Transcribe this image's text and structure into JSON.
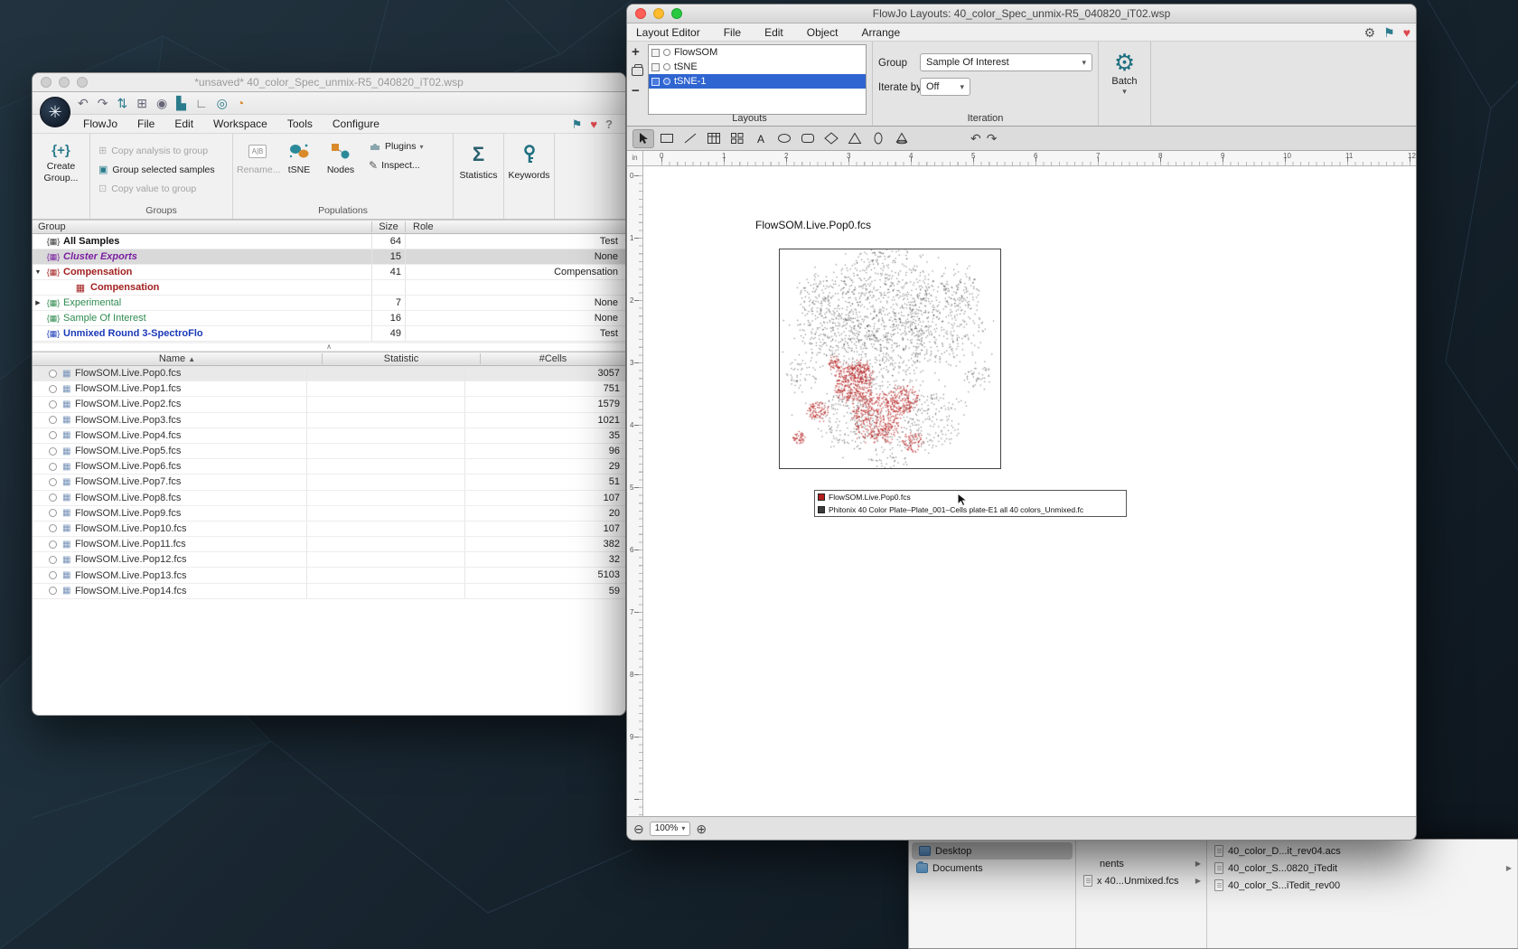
{
  "workspace_window": {
    "title": "*unsaved* 40_color_Spec_unmix-R5_040820_iT02.wsp",
    "logo_glyph": "✳",
    "menus": [
      {
        "label": "FlowJo",
        "name": "menu-flowjo"
      },
      {
        "label": "File",
        "name": "menu-file"
      },
      {
        "label": "Edit",
        "name": "menu-edit"
      },
      {
        "label": "Workspace",
        "name": "menu-workspace"
      },
      {
        "label": "Tools",
        "name": "menu-tools"
      },
      {
        "label": "Configure",
        "name": "menu-configure"
      }
    ],
    "quick_icons": [
      {
        "glyph": "↶",
        "name": "undo-button",
        "cls": "plain"
      },
      {
        "glyph": "↷",
        "name": "redo-button",
        "cls": "plain"
      },
      {
        "glyph": "⇅",
        "name": "transfer-icon",
        "cls": "teal"
      },
      {
        "glyph": "⊞",
        "name": "add-table-icon",
        "cls": "plain"
      },
      {
        "glyph": "◉",
        "name": "search-icon",
        "cls": "plain"
      },
      {
        "glyph": "▙",
        "name": "chart-icon",
        "cls": "teal"
      },
      {
        "glyph": "∟",
        "name": "layout-icon",
        "cls": "plain"
      },
      {
        "glyph": "◎",
        "name": "record-icon",
        "cls": "teal"
      },
      {
        "glyph": "◔",
        "name": "palette-icon",
        "cls": "orange"
      }
    ],
    "corner_icons": [
      {
        "glyph": "⚑",
        "name": "bookmark-icon",
        "cls": "teal"
      },
      {
        "glyph": "♥",
        "name": "favorites-icon",
        "cls": "red"
      },
      {
        "glyph": "?",
        "name": "help-icon",
        "cls": "gray"
      }
    ],
    "ribbon": {
      "create_group_icon": "{+}",
      "create_group_label": "Create Group...",
      "group_actions": [
        {
          "glyph": "⊞",
          "label": "Copy analysis to group",
          "name": "copy-analysis-button",
          "disabled": true
        },
        {
          "glyph": "▣",
          "label": "Group selected samples",
          "name": "group-selected-button"
        },
        {
          "glyph": "⊡",
          "label": "Copy value to group",
          "name": "copy-value-button",
          "disabled": true
        }
      ],
      "groups_caption": "Groups",
      "rename_icon": "A|B",
      "rename_label": "Rename...",
      "tsne_label": "tSNE",
      "nodes_label": "Nodes",
      "plugins_label": "Plugins",
      "plugins_caret": "▾",
      "inspect_icon": "✎",
      "inspect_label": "Inspect...",
      "populations_caption": "Populations",
      "statistics_icon": "Σ",
      "statistics_label": "Statistics",
      "keywords_label": "Keywords"
    },
    "groups_table": {
      "columns": {
        "group": "Group",
        "size": "Size",
        "role": "Role"
      },
      "rows": [
        {
          "disclosure": "",
          "icon": "braces",
          "name": "All Samples",
          "size": "64",
          "role": "Test",
          "style": "g-dark"
        },
        {
          "disclosure": "",
          "icon": "braces",
          "name": "Cluster Exports",
          "size": "15",
          "role": "None",
          "style": "g-purple",
          "selected": true
        },
        {
          "disclosure": "▼",
          "icon": "braces",
          "name": "Compensation",
          "size": "41",
          "role": "Compensation",
          "style": "g-red"
        },
        {
          "disclosure": "",
          "icon": "grid",
          "name": "Compensation",
          "size": "",
          "role": "",
          "style": "g-red",
          "indent": true
        },
        {
          "disclosure": "▶",
          "icon": "braces",
          "name": "Experimental",
          "size": "7",
          "role": "None",
          "style": "g-green"
        },
        {
          "disclosure": "",
          "icon": "braces",
          "name": "Sample Of Interest",
          "size": "16",
          "role": "None",
          "style": "g-green"
        },
        {
          "disclosure": "",
          "icon": "braces",
          "name": "Unmixed Round 3-SpectroFlo",
          "size": "49",
          "role": "Test",
          "style": "g-blue"
        }
      ]
    },
    "scroll_hint": "∧",
    "samples_table": {
      "columns": {
        "name": "Name",
        "statistic": "Statistic",
        "cells": "#Cells"
      },
      "sort_icon": "▲",
      "rows": [
        {
          "name": "FlowSOM.Live.Pop0.fcs",
          "statistic": "",
          "cells": "3057",
          "selected": true
        },
        {
          "name": "FlowSOM.Live.Pop1.fcs",
          "statistic": "",
          "cells": "751"
        },
        {
          "name": "FlowSOM.Live.Pop2.fcs",
          "statistic": "",
          "cells": "1579"
        },
        {
          "name": "FlowSOM.Live.Pop3.fcs",
          "statistic": "",
          "cells": "1021"
        },
        {
          "name": "FlowSOM.Live.Pop4.fcs",
          "statistic": "",
          "cells": "35"
        },
        {
          "name": "FlowSOM.Live.Pop5.fcs",
          "statistic": "",
          "cells": "96"
        },
        {
          "name": "FlowSOM.Live.Pop6.fcs",
          "statistic": "",
          "cells": "29"
        },
        {
          "name": "FlowSOM.Live.Pop7.fcs",
          "statistic": "",
          "cells": "51"
        },
        {
          "name": "FlowSOM.Live.Pop8.fcs",
          "statistic": "",
          "cells": "107"
        },
        {
          "name": "FlowSOM.Live.Pop9.fcs",
          "statistic": "",
          "cells": "20"
        },
        {
          "name": "FlowSOM.Live.Pop10.fcs",
          "statistic": "",
          "cells": "107"
        },
        {
          "name": "FlowSOM.Live.Pop11.fcs",
          "statistic": "",
          "cells": "382"
        },
        {
          "name": "FlowSOM.Live.Pop12.fcs",
          "statistic": "",
          "cells": "32"
        },
        {
          "name": "FlowSOM.Live.Pop13.fcs",
          "statistic": "",
          "cells": "5103"
        },
        {
          "name": "FlowSOM.Live.Pop14.fcs",
          "statistic": "",
          "cells": "59"
        }
      ]
    }
  },
  "layout_window": {
    "title": "FlowJo Layouts: 40_color_Spec_unmix-R5_040820_iT02.wsp",
    "menus": [
      {
        "label": "Layout Editor",
        "name": "menu-layout-editor"
      },
      {
        "label": "File",
        "name": "menu-file"
      },
      {
        "label": "Edit",
        "name": "menu-edit"
      },
      {
        "label": "Object",
        "name": "menu-object"
      },
      {
        "label": "Arrange",
        "name": "menu-arrange"
      }
    ],
    "window_icons": [
      {
        "glyph": "⚙",
        "name": "settings-icon",
        "cls": "dark"
      },
      {
        "glyph": "⚑",
        "name": "bookmark-icon",
        "cls": "teal"
      },
      {
        "glyph": "♥",
        "name": "favorites-icon",
        "cls": "red"
      }
    ],
    "layouts_panel": {
      "add_label": "+",
      "remove_label": "−",
      "items": [
        {
          "label": "FlowSOM"
        },
        {
          "label": "tSNE"
        },
        {
          "label": "tSNE-1",
          "selected": true
        }
      ],
      "caption": "Layouts"
    },
    "group_label": "Group",
    "group_value": "Sample Of Interest",
    "iterate_label": "Iterate by",
    "iterate_value": "Off",
    "iteration_caption": "Iteration",
    "batch_label": "Batch",
    "caret": "▾",
    "tools_a": "A",
    "undo_icon": "↶",
    "redo_icon": "↷",
    "ruler": {
      "unit": "in",
      "h": [
        "0",
        "1",
        "2",
        "3",
        "4",
        "5",
        "6",
        "7",
        "8",
        "9",
        "10",
        "11",
        "12"
      ],
      "v": [
        "0",
        "1",
        "2",
        "3",
        "4",
        "5",
        "6",
        "7",
        "8",
        "9"
      ]
    },
    "page": {
      "plot_title": "FlowSOM.Live.Pop0.fcs",
      "legend": [
        {
          "color": "#b51d1d",
          "label": "FlowSOM.Live.Pop0.fcs"
        },
        {
          "color": "#3a3a3a",
          "label": "Phitonix 40 Color Plate–Plate_001–Cells plate-E1 all 40 colors_Unmixed.fc"
        }
      ]
    },
    "zoom_out": "⊖",
    "zoom_in": "⊕",
    "zoom_value": "100%"
  },
  "finder_window": {
    "col1": [
      {
        "label": "Desktop",
        "icon": "desktop",
        "selected": true
      },
      {
        "label": "Documents",
        "icon": "folder"
      }
    ],
    "col2": [
      {
        "label": "nents",
        "chevron": "▶"
      },
      {
        "label": "x 40...Unmixed.fcs",
        "icon": "doc",
        "chevron": "▶"
      }
    ],
    "col3": [
      {
        "label": "40_color_D...it_rev04.acs",
        "icon": "doc"
      },
      {
        "label": "40_color_S...0820_iTedit",
        "icon": "doc",
        "chevron": "▶"
      },
      {
        "label": "40_color_S...iTedit_rev00",
        "icon": "doc"
      }
    ]
  },
  "chart_data": {
    "type": "scatter",
    "title": "FlowSOM.Live.Pop0.fcs",
    "plot_size": [
      244,
      242
    ],
    "legend_entries": [
      "FlowSOM.Live.Pop0.fcs",
      "Phitonix 40 Color Plate–Plate_001–Cells plate-E1 all 40 colors_Unmixed.fc"
    ],
    "series": [
      {
        "name": "Phitonix 40 Color Plate–Plate_001–Cells plate-E1 all 40 colors_Unmixed.fc",
        "color": "#1c1c1c",
        "alpha": 0.55,
        "clusters": [
          {
            "x": 115,
            "y": 52,
            "r": 55,
            "n": 520
          },
          {
            "x": 55,
            "y": 88,
            "r": 36,
            "n": 240
          },
          {
            "x": 178,
            "y": 78,
            "r": 44,
            "n": 300
          },
          {
            "x": 115,
            "y": 112,
            "r": 50,
            "n": 300
          },
          {
            "x": 40,
            "y": 48,
            "r": 22,
            "n": 80
          },
          {
            "x": 198,
            "y": 42,
            "r": 24,
            "n": 85
          },
          {
            "x": 76,
            "y": 188,
            "r": 32,
            "n": 150
          },
          {
            "x": 166,
            "y": 188,
            "r": 32,
            "n": 150
          },
          {
            "x": 24,
            "y": 138,
            "r": 17,
            "n": 45
          },
          {
            "x": 221,
            "y": 138,
            "r": 16,
            "n": 45
          },
          {
            "x": 120,
            "y": 118,
            "r": 110,
            "n": 280
          },
          {
            "x": 120,
            "y": 222,
            "r": 24,
            "n": 60
          }
        ]
      },
      {
        "name": "FlowSOM.Live.Pop0.fcs",
        "color": "#b51d1d",
        "alpha": 0.9,
        "clusters": [
          {
            "x": 80,
            "y": 148,
            "r": 21,
            "n": 340
          },
          {
            "x": 108,
            "y": 186,
            "r": 27,
            "n": 440
          },
          {
            "x": 137,
            "y": 165,
            "r": 16,
            "n": 170
          },
          {
            "x": 42,
            "y": 178,
            "r": 11,
            "n": 90
          },
          {
            "x": 20,
            "y": 208,
            "r": 7,
            "n": 45
          },
          {
            "x": 147,
            "y": 213,
            "r": 11,
            "n": 70
          },
          {
            "x": 88,
            "y": 135,
            "r": 13,
            "n": 110
          },
          {
            "x": 60,
            "y": 126,
            "r": 8,
            "n": 50
          }
        ]
      }
    ]
  }
}
